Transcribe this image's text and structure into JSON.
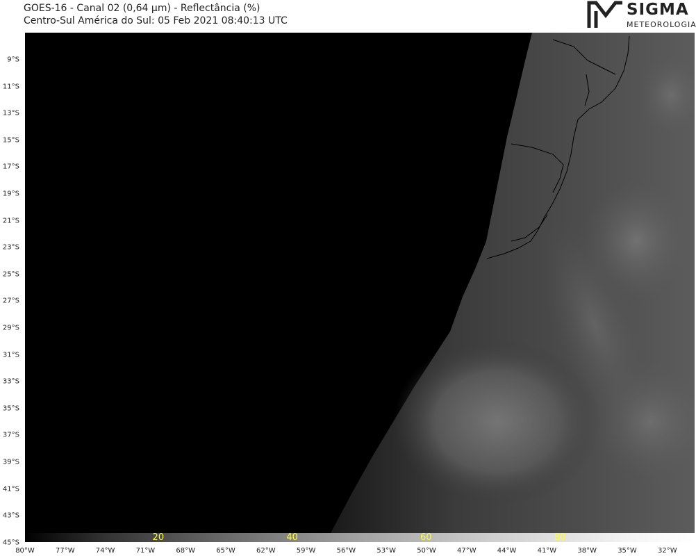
{
  "header": {
    "title_line1": "GOES-16 - Canal 02 (0,64 µm) - Reflectância (%)",
    "title_line2": "Centro-Sul América do Sul:  05 Feb 2021 08:40:13 UTC"
  },
  "logo": {
    "brand": "SIGMA",
    "sub": "METEOROLOGIA"
  },
  "colorbar": {
    "labels": [
      "20",
      "40",
      "60",
      "80"
    ],
    "label_color": "#ffff33"
  },
  "axes": {
    "lat_labels": [
      "9°S",
      "11°S",
      "13°S",
      "15°S",
      "17°S",
      "19°S",
      "21°S",
      "23°S",
      "25°S",
      "27°S",
      "29°S",
      "31°S",
      "33°S",
      "35°S",
      "37°S",
      "39°S",
      "41°S",
      "43°S",
      "45°S"
    ],
    "lon_labels": [
      "80°W",
      "77°W",
      "74°W",
      "71°W",
      "68°W",
      "65°W",
      "62°W",
      "59°W",
      "56°W",
      "53°W",
      "50°W",
      "47°W",
      "44°W",
      "41°W",
      "38°W",
      "35°W",
      "32°W"
    ]
  }
}
